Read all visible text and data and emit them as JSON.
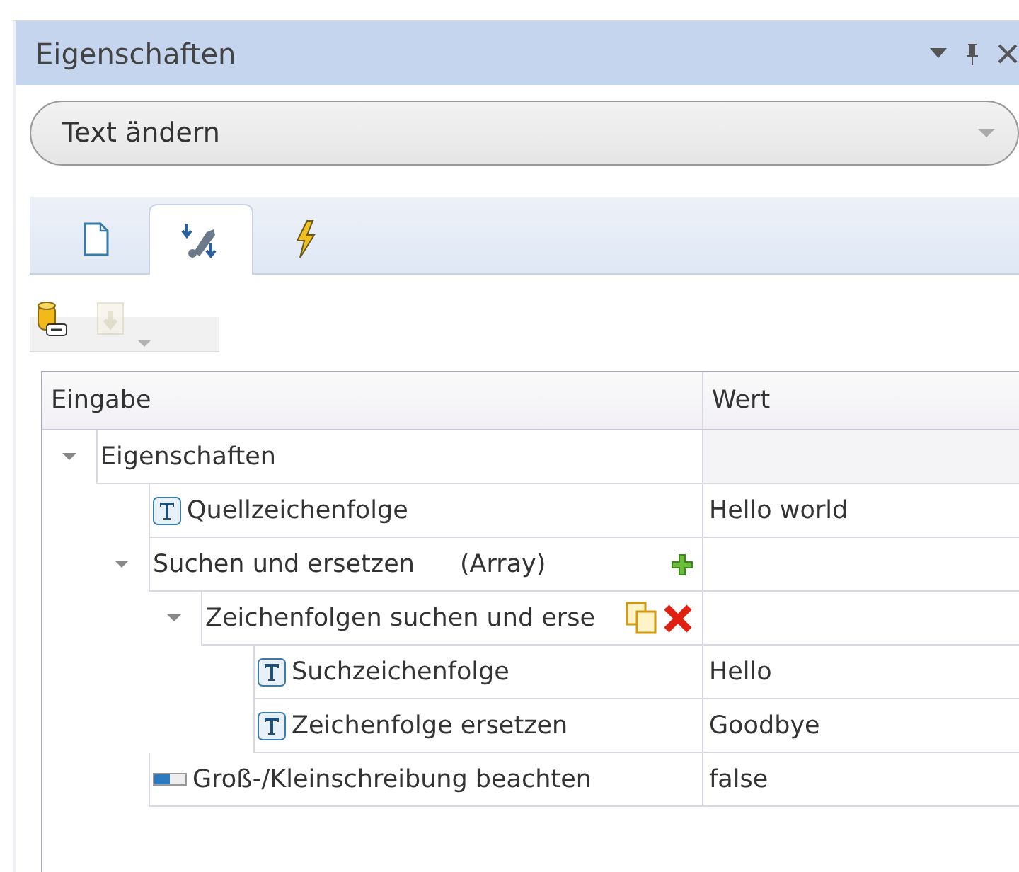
{
  "panel": {
    "title": "Eigenschaften"
  },
  "action_select": {
    "value": "Text ändern"
  },
  "tabs": [
    {
      "selected": false
    },
    {
      "selected": true
    },
    {
      "selected": false
    }
  ],
  "toolbar": [
    {
      "disabled": false
    },
    {
      "disabled": true
    }
  ],
  "table": {
    "columns": [
      "Eingabe",
      "Wert"
    ],
    "rows": [
      {
        "kind": "group",
        "label": "Eigenschaften",
        "expanded": true,
        "children": [
          {
            "kind": "text",
            "label": "Quellzeichenfolge",
            "value": "Hello world"
          },
          {
            "kind": "array",
            "label": "Suchen und ersetzen",
            "note": "(Array)",
            "expanded": true,
            "children": [
              {
                "kind": "item",
                "label": "Zeichenfolgen suchen und erse",
                "expanded": true,
                "children": [
                  {
                    "kind": "text",
                    "label": "Suchzeichenfolge",
                    "value": "Hello"
                  },
                  {
                    "kind": "text",
                    "label": "Zeichenfolge ersetzen",
                    "value": "Goodbye"
                  }
                ]
              }
            ]
          },
          {
            "kind": "bool",
            "label": "Groß-/Kleinschreibung beachten",
            "value": "false"
          }
        ]
      }
    ]
  }
}
